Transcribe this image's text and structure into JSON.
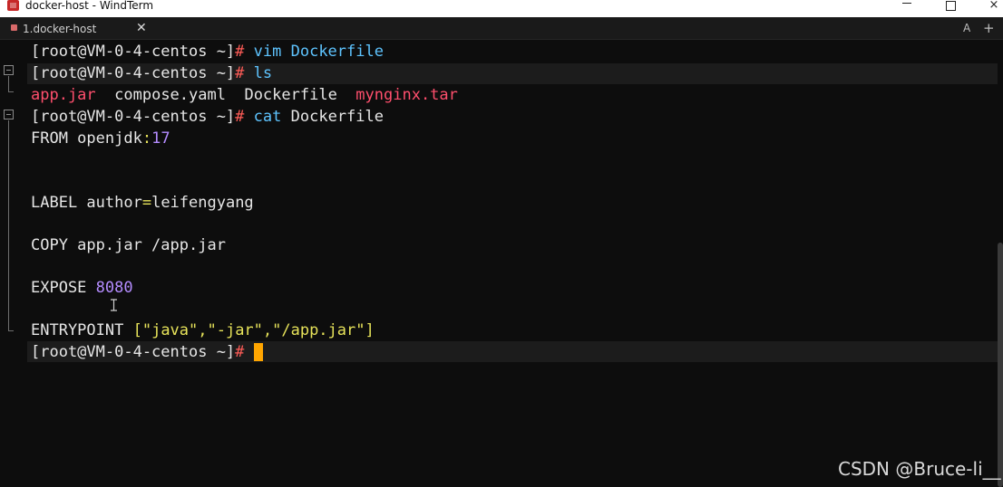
{
  "window": {
    "title": "docker-host - WindTerm",
    "controls": {
      "minimize": "minimize",
      "maximize": "maximize",
      "close": "×"
    }
  },
  "tabs": [
    {
      "label": "1.docker-host",
      "close": "✕",
      "active": true
    }
  ],
  "tabbar": {
    "font_button": "A",
    "add_button": "+"
  },
  "terminal": {
    "prompt": "[root@VM-0-4-centos ~]",
    "prompt_symbol": "#",
    "lines": {
      "l1_cmd": "vim Dockerfile",
      "l2_cmd": "ls",
      "ls_output": [
        "app.jar",
        "compose.yaml",
        "Dockerfile",
        "mynginx.tar"
      ],
      "l4_cmd": "cat",
      "l4_arg": "Dockerfile",
      "from_kw": "FROM openjdk",
      "from_colon": ":",
      "from_ver": "17",
      "label_kw": "LABEL author",
      "label_eq": "=",
      "label_val": "leifengyang",
      "copy_line": "COPY app.jar /app.jar",
      "expose_kw": "EXPOSE",
      "expose_port": "8080",
      "entry_kw": "ENTRYPOINT",
      "entry_arr": "[\"java\",\"-jar\",\"/app.jar\"]"
    }
  },
  "watermark": "CSDN @Bruce-li__",
  "colors": {
    "background": "#0d0d0d",
    "prompt_hash": "#ff5c57",
    "command": "#5ec4ff",
    "file_highlight": "#ff4f6d",
    "number": "#b48cff",
    "string": "#e7e35a",
    "cursor": "#ffa500"
  }
}
